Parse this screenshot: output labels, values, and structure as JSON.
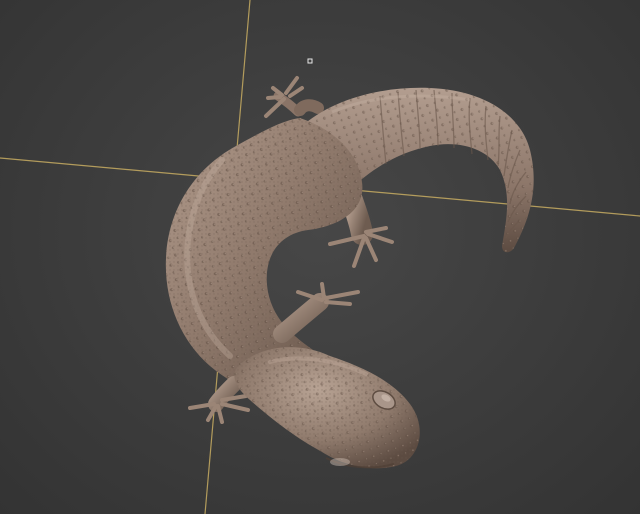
{
  "viewport": {
    "background_color": "#3c3c3c",
    "axis_line_color": "#c8ad62",
    "model_base_color": "#8f7a6c",
    "model_shadow_color": "#4e3f35",
    "model_highlight_color": "#c8b3a4"
  },
  "icons": {
    "pivot_marker": "small-square-marker"
  }
}
